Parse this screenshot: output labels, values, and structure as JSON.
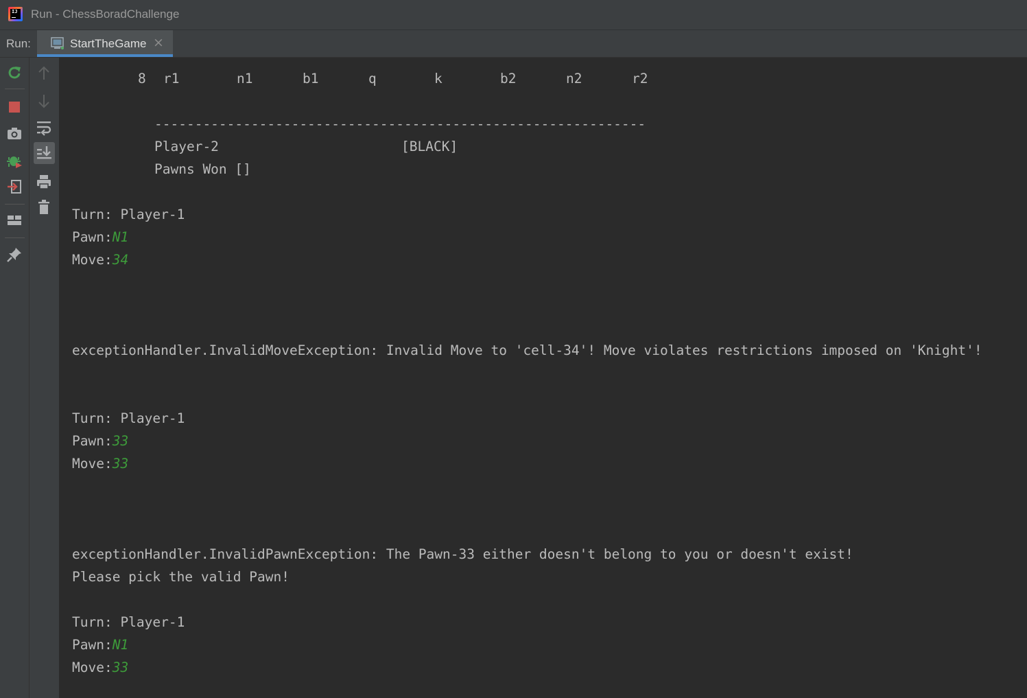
{
  "window": {
    "title": "Run - ChessBoradChallenge"
  },
  "runbar": {
    "label": "Run:",
    "tab_label": "StartTheGame",
    "close_glyph": "×"
  },
  "toolbar_left": [
    {
      "name": "rerun-icon",
      "color": "#499c54"
    },
    {
      "name": "stop-icon",
      "color": "#c75450"
    },
    {
      "name": "camera-icon",
      "color": "#afb1b3"
    },
    {
      "name": "debug-icon",
      "color": "#499c54"
    },
    {
      "name": "exit-icon",
      "color": "#afb1b3"
    },
    {
      "name": "layout-icon",
      "color": "#afb1b3"
    },
    {
      "name": "pin-icon",
      "color": "#afb1b3"
    }
  ],
  "toolbar_right": [
    {
      "name": "arrow-up-icon"
    },
    {
      "name": "arrow-down-icon"
    },
    {
      "name": "soft-wrap-icon"
    },
    {
      "name": "scroll-to-end-icon"
    },
    {
      "name": "print-icon"
    },
    {
      "name": "trash-icon"
    }
  ],
  "console": {
    "rank_row": {
      "rank": "8",
      "cells": [
        "r1",
        "n1",
        "b1",
        "q",
        "k",
        "b2",
        "n2",
        "r2"
      ]
    },
    "divider": "-------------------------------------------------------------",
    "player_name": "Player-2",
    "player_color": "[BLACK]",
    "pawns_won": "Pawns Won []",
    "blocks": [
      {
        "turn": "Turn: Player-1",
        "pawn_label": "Pawn:",
        "pawn_input": "N1",
        "move_label": "Move:",
        "move_input": "34"
      },
      {
        "turn": "Turn: Player-1",
        "pawn_label": "Pawn:",
        "pawn_input": "33",
        "move_label": "Move:",
        "move_input": "33"
      },
      {
        "turn": "Turn: Player-1",
        "pawn_label": "Pawn:",
        "pawn_input": "N1",
        "move_label": "Move:",
        "move_input": "33"
      }
    ],
    "error_move": "exceptionHandler.InvalidMoveException: Invalid Move to 'cell-34'! Move violates restrictions imposed on 'Knight'!",
    "error_pawn": "exceptionHandler.InvalidPawnException: The Pawn-33 either doesn't belong to you or doesn't exist!",
    "error_pawn_hint": "Please pick the valid Pawn!"
  },
  "colors": {
    "console_bg": "#2b2b2b",
    "console_text": "#bbbbbb",
    "user_input": "#3d9b3a",
    "toolbar_bg": "#3c3f41",
    "tab_underline": "#4a88c7"
  }
}
